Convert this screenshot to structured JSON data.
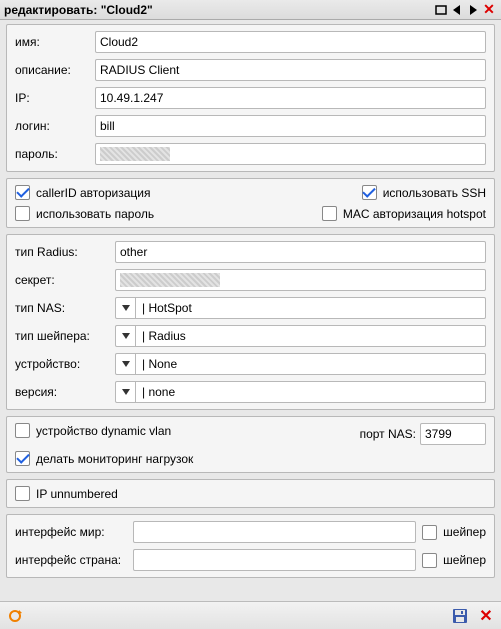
{
  "titlebar": {
    "title": "редактировать: \"Cloud2\""
  },
  "basic": {
    "name_label": "имя:",
    "name_value": "Cloud2",
    "desc_label": "описание:",
    "desc_value": "RADIUS Client",
    "ip_label": "IP:",
    "ip_value": "10.49.1.247",
    "login_label": "логин:",
    "login_value": "bill",
    "pass_label": "пароль:"
  },
  "flags": {
    "callerid_label": "callerID авторизация",
    "callerid": true,
    "ssh_label": "использовать SSH",
    "ssh": true,
    "usepass_label": "использовать пароль",
    "usepass": false,
    "macauth_label": "MAC авторизация hotspot",
    "macauth": false
  },
  "radius": {
    "type_label": "тип Radius:",
    "type_value": "other",
    "secret_label": "секрет:",
    "nastype_label": "тип NAS:",
    "nastype_value": "| HotSpot",
    "shaper_label": "тип шейпера:",
    "shaper_value": "| Radius",
    "device_label": "устройство:",
    "device_value": "| None",
    "version_label": "версия:",
    "version_value": "| none"
  },
  "extra": {
    "dyn_vlan_label": "устройство dynamic vlan",
    "dyn_vlan": false,
    "nasport_label": "порт NAS:",
    "nasport_value": "3799",
    "monitor_label": "делать мониторинг нагрузок",
    "monitor": true
  },
  "ipun": {
    "label": "IP unnumbered",
    "checked": false
  },
  "iface": {
    "world_label": "интерфейс мир:",
    "world_value": "",
    "world_shaper_label": "шейпер",
    "world_shaper": false,
    "country_label": "интерфейс страна:",
    "country_value": "",
    "country_shaper_label": "шейпер",
    "country_shaper": false
  }
}
